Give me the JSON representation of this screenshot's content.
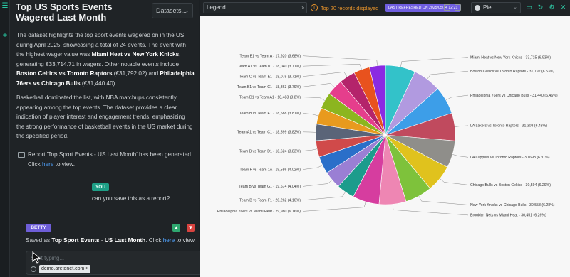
{
  "chat": {
    "title": "Top US Sports Events Wagered Last Month",
    "dataset_select": "Datasets...",
    "paragraph1_a": "The dataset highlights the top sport events wagered on in the US during April 2025, showcasing a total of 24 events. The event with the highest wager value was ",
    "paragraph1_b": "Miami Heat vs New York Knicks",
    "paragraph1_c": ", generating €33,714.71 in wagers. Other notable events include ",
    "paragraph1_d": "Boston Celtics vs Toronto Raptors",
    "paragraph1_e": " (€31,792.02) and ",
    "paragraph1_f": "Philadelphia 76ers vs Chicago Bulls",
    "paragraph1_g": " (€31,440.40).",
    "paragraph2": "Basketball dominated the list, with NBA matchups consistently appearing among the top events. The dataset provides a clear indication of player interest and engagement trends, emphasizing the strong performance of basketball events in the US market during the specified period.",
    "report_a": "Report 'Top Sport Events - US Last Month' has been generated. Click ",
    "report_link": "here",
    "report_b": " to view.",
    "you_badge": "YOU",
    "you_message": "can you save this as a report?",
    "betty_badge": "BETTY",
    "saved_a": "Saved as ",
    "saved_b": "Top Sport Events - US Last Month",
    "saved_c": ". Click ",
    "saved_link": "here",
    "saved_d": " to view.",
    "input_placeholder": "Start typing...",
    "chip": "demo.aretonet.com ×"
  },
  "toolbar": {
    "legend_label": "Legend",
    "records_text": "Top 20 records displayed",
    "refreshed_badge": "LAST REFRESHED ON 2025/05/14 12:21",
    "chart_type": "Pie",
    "accent": "#2fc9a5"
  },
  "chart_data": {
    "type": "pie",
    "title": "",
    "slices": [
      {
        "label": "Miami Heat vs New York Knicks - 33,715 (6.93%)",
        "value": 33715,
        "color": "#33c2c9"
      },
      {
        "label": "Boston Celtics vs Toronto Raptors - 31,792 (6.53%)",
        "value": 31792,
        "color": "#b19ae0"
      },
      {
        "label": "Philadelphia 76ers vs Chicago Bulls - 31,440 (6.46%)",
        "value": 31440,
        "color": "#3d9ee8"
      },
      {
        "label": "LA Lakers vs Toronto Raptors - 31,308 (6.43%)",
        "value": 31308,
        "color": "#c04a5e"
      },
      {
        "label": "LA Clippers vs Toronto Raptors - 30,698 (6.31%)",
        "value": 30698,
        "color": "#8f8e8a"
      },
      {
        "label": "Chicago Bulls vs Boston Celtics - 30,594 (6.29%)",
        "value": 30594,
        "color": "#e0c21d"
      },
      {
        "label": "New York Knicks vs Chicago Bulls - 30,558 (6.28%)",
        "value": 30558,
        "color": "#7ec23b"
      },
      {
        "label": "Brooklyn Nets vs Miami Heat - 30,451 (6.26%)",
        "value": 30451,
        "color": "#ee86b3"
      },
      {
        "label": "Philadelphia 76ers vs Miami Heat - 29,980 (6.16%)",
        "value": 29980,
        "color": "#d63d9f"
      },
      {
        "label": "Team B vs Team F1 - 20,262 (4.16%)",
        "value": 20262,
        "color": "#1c9c8c"
      },
      {
        "label": "Team B vs Team G1 - 19,674 (4.04%)",
        "value": 19674,
        "color": "#9a7fd4"
      },
      {
        "label": "Team F vs Team 1A - 19,586 (4.02%)",
        "value": 19586,
        "color": "#2a6fc9"
      },
      {
        "label": "Team B vs Team D1 - 18,624 (3.83%)",
        "value": 18624,
        "color": "#d04a4a"
      },
      {
        "label": "Team A1 vs Team C1 - 18,599 (3.82%)",
        "value": 18599,
        "color": "#5a6478"
      },
      {
        "label": "Team B vs Team E1 - 18,588 (3.81%)",
        "value": 18588,
        "color": "#e89a1e"
      },
      {
        "label": "Team D1 vs Team A1 - 18,483 (3.8%)",
        "value": 18483,
        "color": "#8cb51f"
      },
      {
        "label": "Team B1 vs Team C1 - 18,363 (3.79%)",
        "value": 18363,
        "color": "#e53e8c"
      },
      {
        "label": "Team C vs Team E1 - 18,075 (3.71%)",
        "value": 18075,
        "color": "#b4246b"
      },
      {
        "label": "Team A1 vs Team b1 - 18,040 (3.71%)",
        "value": 18040,
        "color": "#e8521e"
      },
      {
        "label": "Team E1 vs Team A - 17,920 (3.68%)",
        "value": 17920,
        "color": "#8a2be2"
      }
    ]
  }
}
